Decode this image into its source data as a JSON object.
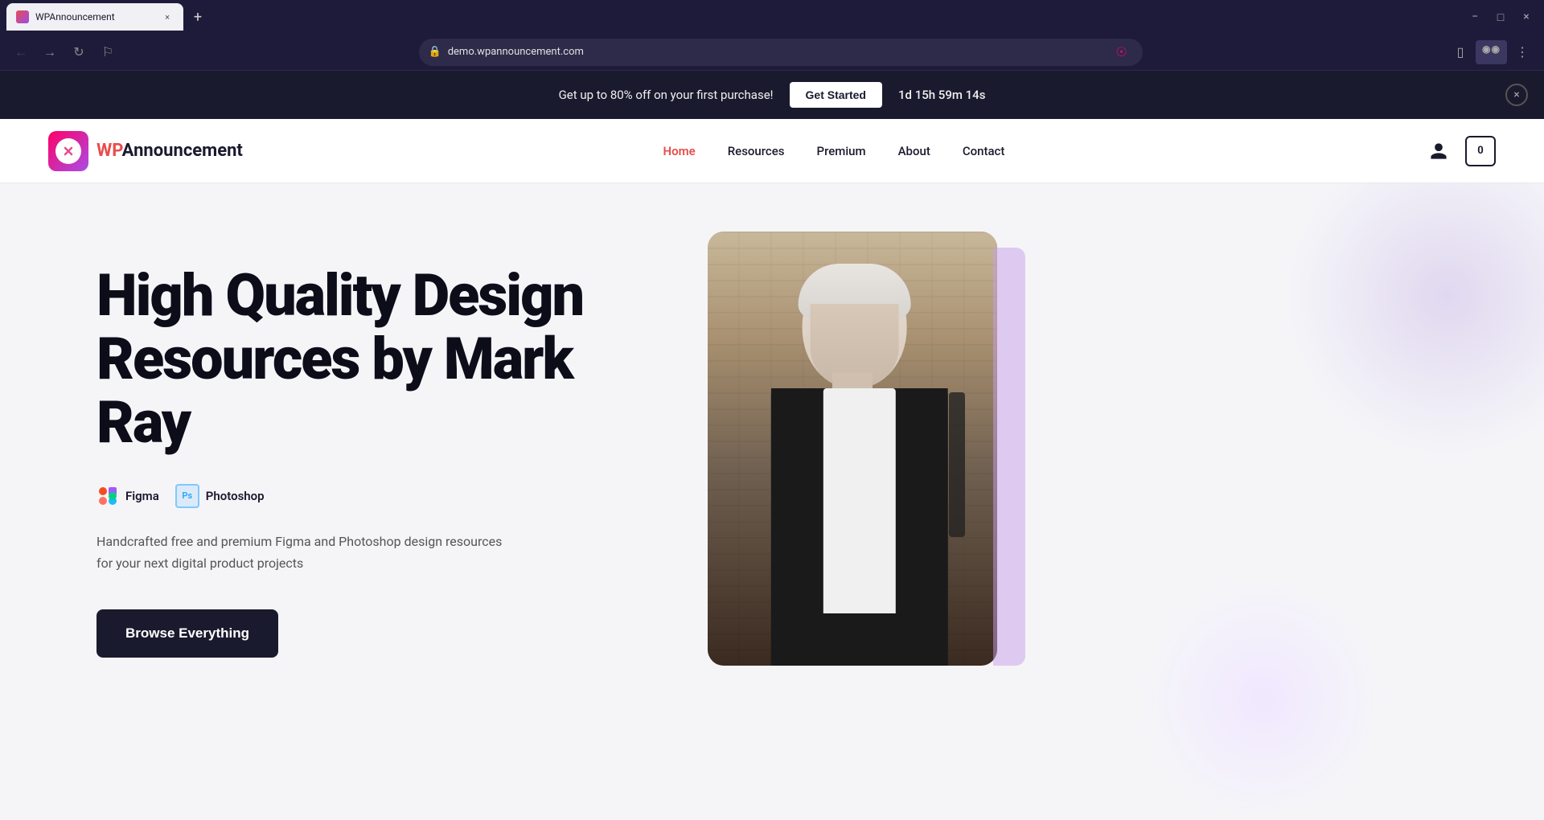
{
  "browser": {
    "tab_title": "WPAnnouncement",
    "tab_favicon": "wp-icon",
    "url": "demo.wpannouncement.com",
    "new_tab_label": "+",
    "window_controls": {
      "minimize": "−",
      "maximize": "□",
      "close": "×"
    },
    "nav": {
      "back_disabled": true,
      "forward_disabled": false
    }
  },
  "announcement_bar": {
    "text": "Get up to 80% off on your first purchase!",
    "cta_label": "Get Started",
    "timer": "1d 15h 59m 14s",
    "close_label": "×"
  },
  "site_header": {
    "logo_brand": "WP",
    "logo_name_prefix": "WP",
    "logo_name_suffix": "Announcement",
    "nav_links": [
      {
        "label": "Home",
        "active": true
      },
      {
        "label": "Resources",
        "active": false
      },
      {
        "label": "Premium",
        "active": false
      },
      {
        "label": "About",
        "active": false
      },
      {
        "label": "Contact",
        "active": false
      }
    ],
    "cart_count": "0"
  },
  "hero": {
    "title": "High Quality Design Resources by Mark Ray",
    "badge_figma": "Figma",
    "badge_photoshop": "Photoshop",
    "ps_abbr": "Ps",
    "description": "Handcrafted free and premium Figma and Photoshop design resources for your next digital product projects",
    "cta_label": "Browse Everything"
  }
}
